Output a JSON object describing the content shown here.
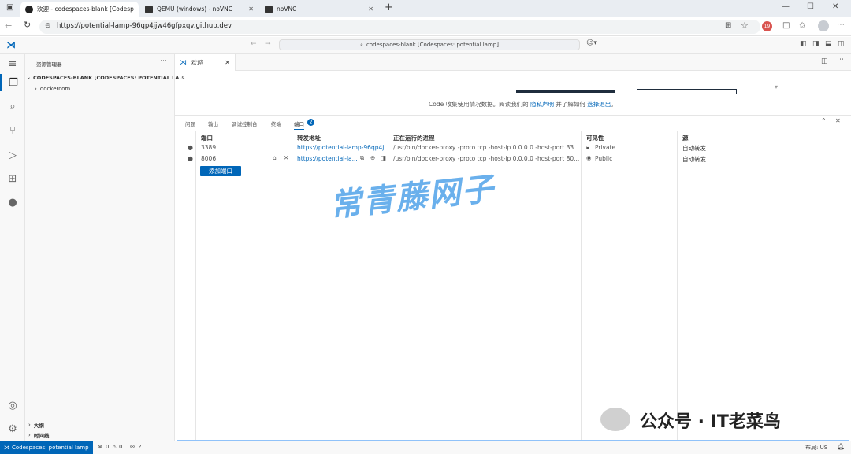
{
  "browser": {
    "tabs": [
      {
        "label": "欢迎 - codespaces-blank [Codesp",
        "icon": "github-icon"
      },
      {
        "label": "QEMU (windows) - noVNC",
        "icon": "novnc-icon"
      },
      {
        "label": "noVNC",
        "icon": "novnc-icon"
      }
    ],
    "url": "https://potential-lamp-96qp4jjw46gfpxqv.github.dev",
    "profile_badge": "19"
  },
  "vscode": {
    "command_center": "codespaces-blank [Codespaces: potential lamp]",
    "sidebar": {
      "title": "资源管理器",
      "workspace": "CODESPACES-BLANK [CODESPACES: POTENTIAL LA...",
      "items": [
        "dockercom"
      ],
      "outline": "大纲",
      "timeline": "时间线"
    },
    "editor": {
      "tab": "欢迎",
      "telemetry_prefix": "Code 收集使用情况数据。阅读我们的",
      "privacy_link": "隐私声明",
      "telemetry_mid": "并了解如何",
      "optout_link": "选择退出",
      "telemetry_end": "。"
    },
    "panel": {
      "tabs": [
        "问题",
        "输出",
        "调试控制台",
        "终端",
        "端口"
      ],
      "ports_count": "2",
      "columns": [
        "端口",
        "转发地址",
        "正在运行的进程",
        "可见性",
        "源"
      ],
      "rows": [
        {
          "port": "3389",
          "address": "https://potential-lamp-96qp4j...",
          "process": "/usr/bin/docker-proxy -proto tcp -host-ip 0.0.0.0 -host-port 33...",
          "visibility": "Private",
          "source": "自动转发"
        },
        {
          "port": "8006",
          "address": "https://potential-la...",
          "process": "/usr/bin/docker-proxy -proto tcp -host-ip 0.0.0.0 -host-port 80...",
          "visibility": "Public",
          "source": "自动转发"
        }
      ],
      "add_port": "添加端口"
    },
    "statusbar": {
      "remote": "Codespaces: potential lamp",
      "errors": "0",
      "warnings": "0",
      "ports": "2",
      "layout": "布局: US"
    }
  },
  "watermarks": {
    "main": "常青藤网子",
    "corner": "公众号 · IT老菜鸟"
  },
  "colors": {
    "accent": "#0066b8",
    "watermark": "#5aa8ea"
  }
}
